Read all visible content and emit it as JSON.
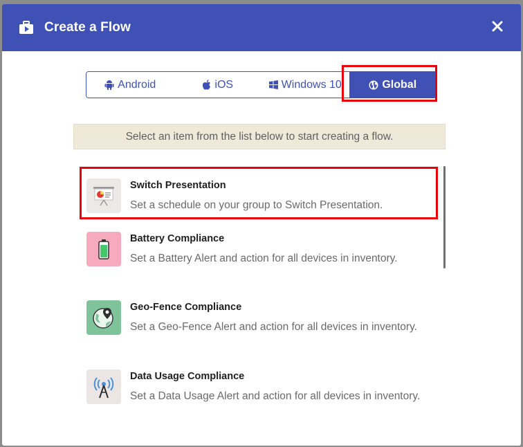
{
  "dialog": {
    "title": "Create a Flow",
    "header_icon": "briefcase-play-icon",
    "close_icon": "close-icon"
  },
  "tabs": [
    {
      "label": "Android",
      "icon": "android-icon",
      "active": false
    },
    {
      "label": "iOS",
      "icon": "apple-icon",
      "active": false
    },
    {
      "label": "Windows 10",
      "icon": "windows-icon",
      "active": false
    },
    {
      "label": "Global",
      "icon": "globe-icon",
      "active": true
    }
  ],
  "banner": {
    "text": "Select an item from the list below to start creating a flow."
  },
  "items": [
    {
      "title": "Switch Presentation",
      "description": "Set a schedule on your group to Switch Presentation.",
      "icon": "presentation-board-icon",
      "icon_bg": "#ebeae6"
    },
    {
      "title": "Battery Compliance",
      "description": "Set a Battery Alert and action for all devices in inventory.",
      "icon": "battery-icon",
      "icon_bg": "#f7a9be"
    },
    {
      "title": "Geo-Fence Compliance",
      "description": "Set a Geo-Fence Alert and action for all devices in inventory.",
      "icon": "map-pin-globe-icon",
      "icon_bg": "#7fc39a"
    },
    {
      "title": "Data Usage Compliance",
      "description": "Set a Data Usage Alert and action for all devices in inventory.",
      "icon": "signal-tower-icon",
      "icon_bg": "#ebe5e3"
    }
  ],
  "colors": {
    "primary": "#3f51b5",
    "highlight": "#e8000b",
    "banner_bg": "#efe9da"
  }
}
